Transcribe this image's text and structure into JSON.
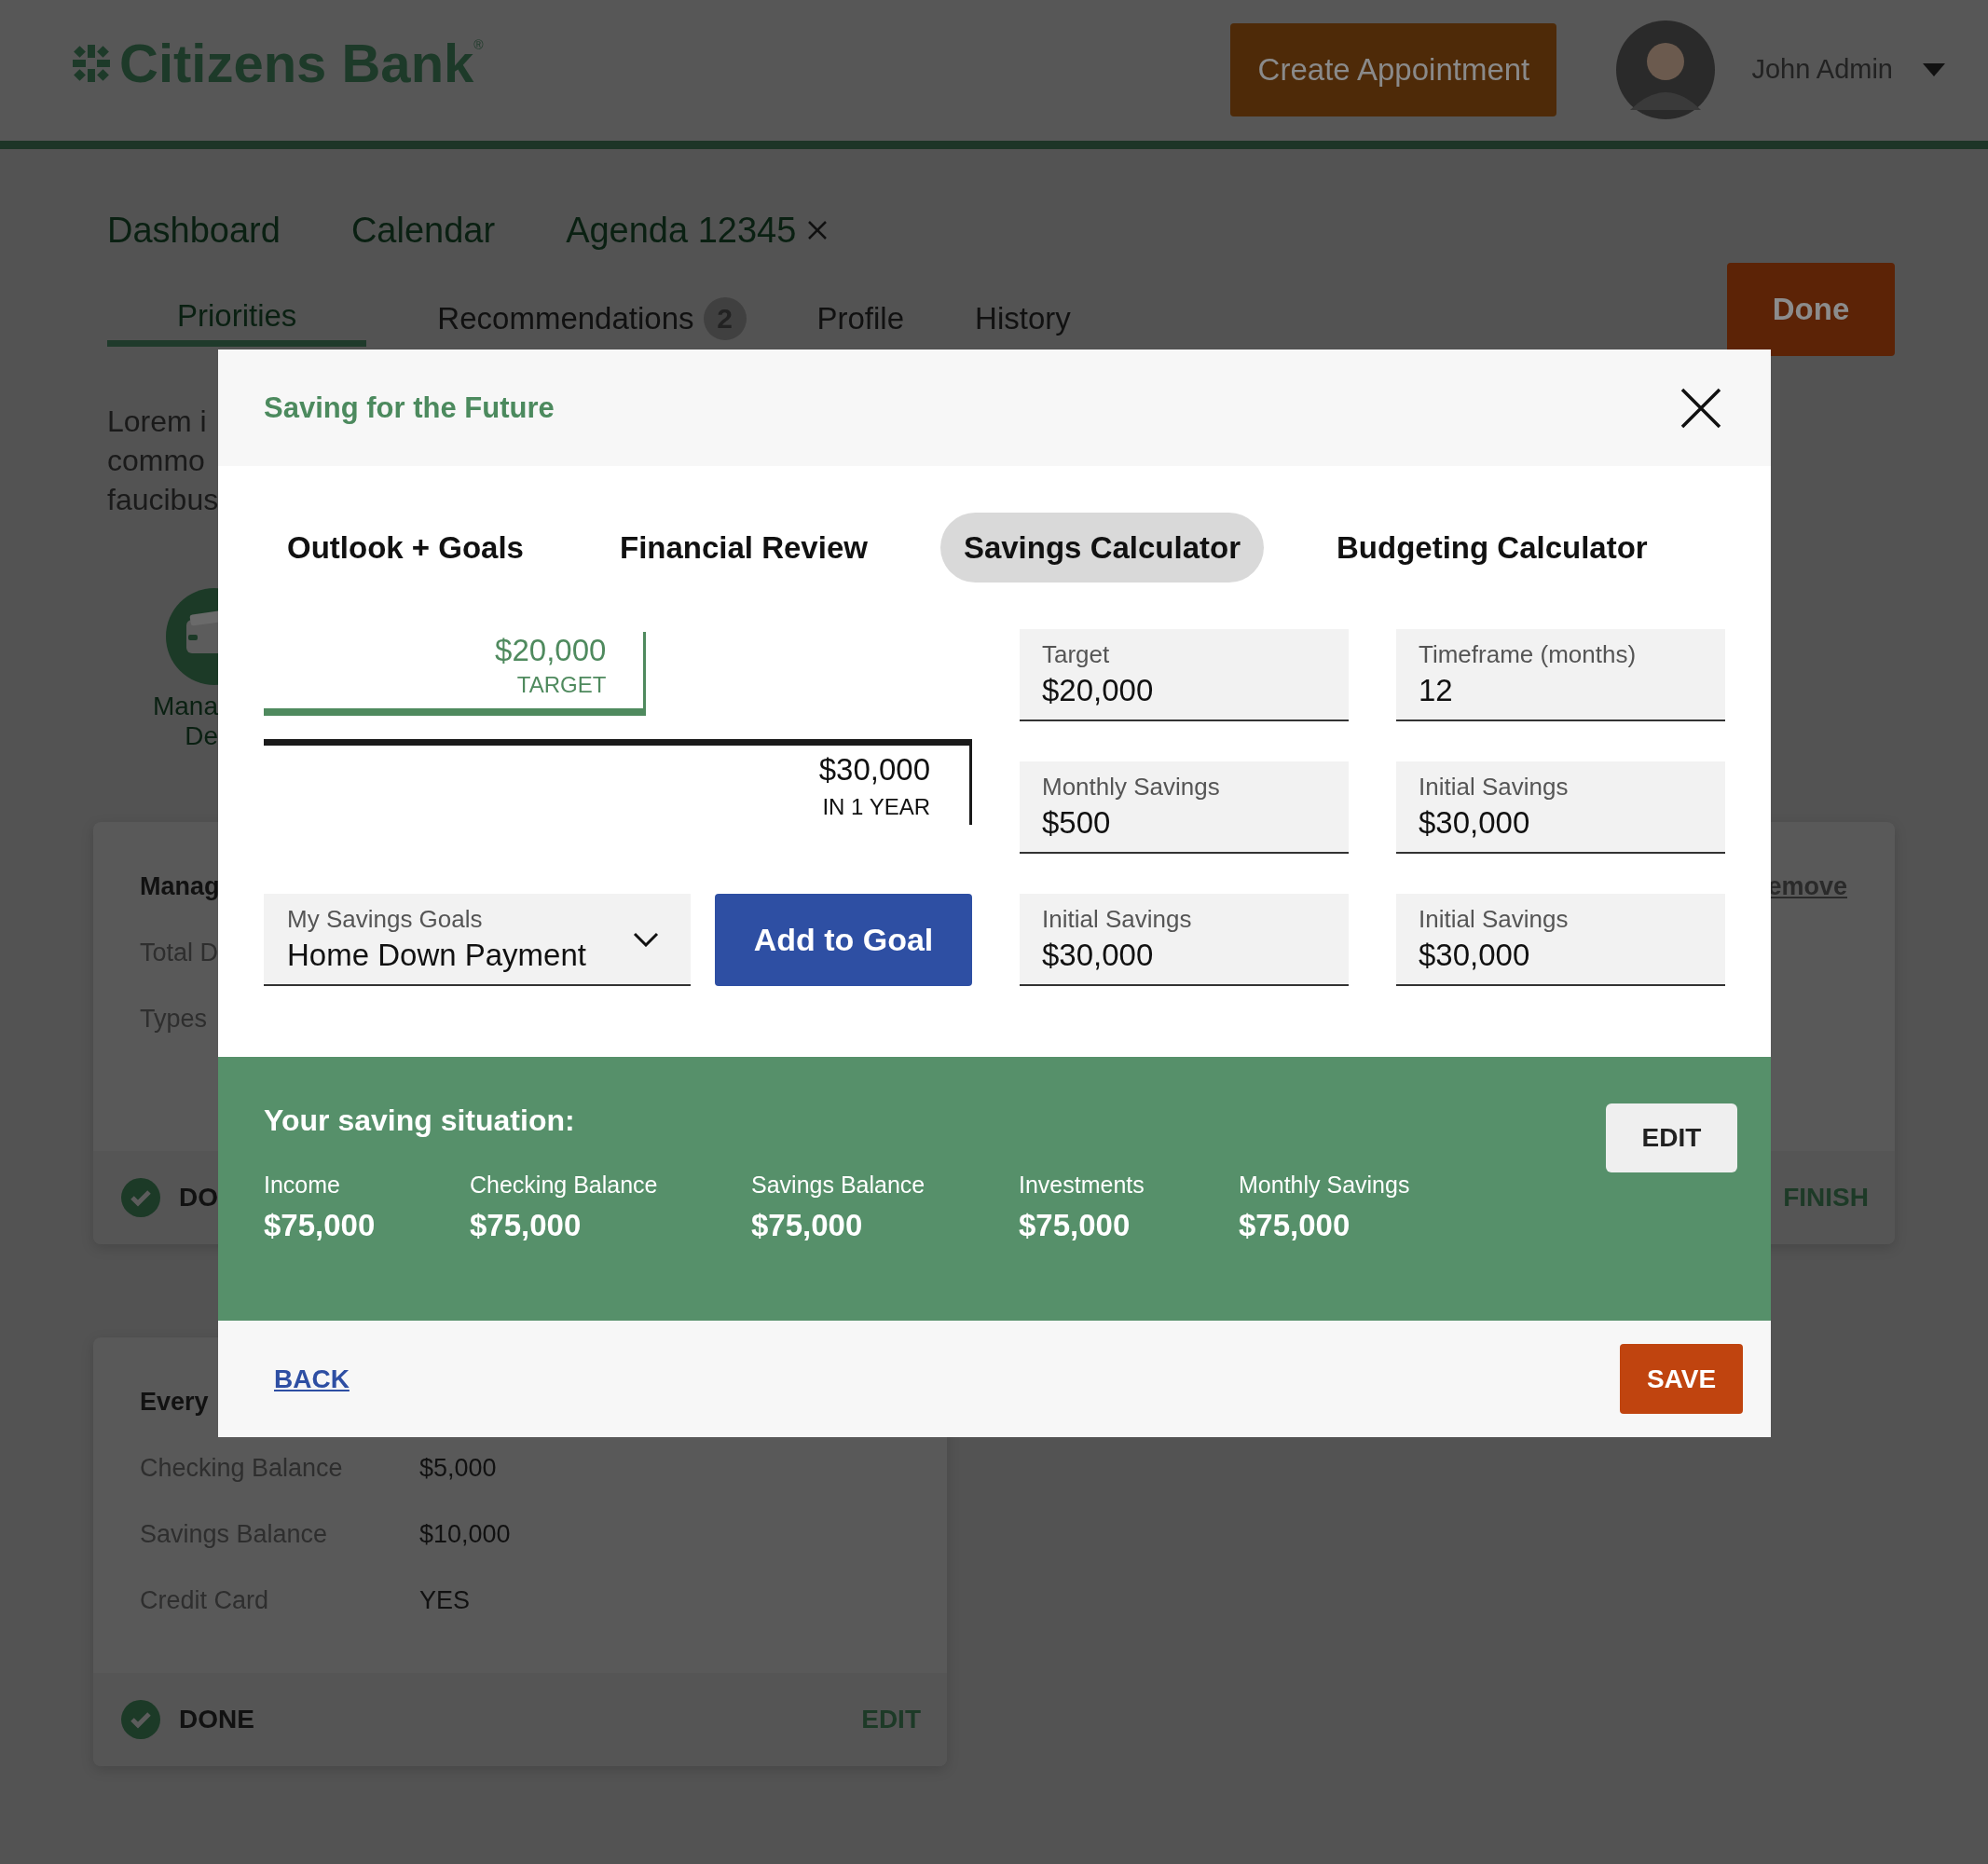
{
  "header": {
    "logo": "Citizens Bank$^{®}$",
    "create_button": "Create Appointment",
    "user_name": "John Admin"
  },
  "nav": [
    {
      "label": "Dashboard",
      "closable": false
    },
    {
      "label": "Calendar",
      "closable": false
    },
    {
      "label": "Agenda 12345",
      "closable": true
    }
  ],
  "tabs": [
    {
      "label": "Priorities",
      "selected": true
    },
    {
      "label": "Recommendations",
      "selected": false,
      "badge": "2"
    },
    {
      "label": "Profile",
      "selected": false
    },
    {
      "label": "History",
      "selected": false
    }
  ],
  "done_button": "Done",
  "intro_lines": [
    "Lorem i",
    "commo",
    "faucibus"
  ],
  "shortcut": {
    "label_lines": [
      "Mana",
      "De"
    ]
  },
  "cards": [
    {
      "title": "Manag",
      "link": "emove",
      "rows": [
        {
          "label": "Total D"
        },
        {
          "label": "Types"
        }
      ],
      "status": "DO",
      "done": true,
      "action": "FINISH"
    },
    {
      "title": "Every",
      "rows": [
        {
          "label": "Checking Balance",
          "value": "$5,000"
        },
        {
          "label": "Savings Balance",
          "value": "$10,000"
        },
        {
          "label": "Credit Card",
          "value": "YES"
        }
      ],
      "status": "DONE",
      "done": true,
      "action": "EDIT"
    }
  ],
  "modal": {
    "title": "Saving for the Future",
    "tabs": [
      {
        "label": "Outlook + Goals",
        "selected": false
      },
      {
        "label": "Financial Review",
        "selected": false
      },
      {
        "label": "Savings Calculator",
        "selected": true
      },
      {
        "label": "Budgeting Calculator",
        "selected": false
      }
    ],
    "chart": {
      "target_amount": "$20,000",
      "target_label": "TARGET",
      "projected_amount": "$30,000",
      "projected_label": "IN 1 YEAR"
    },
    "fields": [
      {
        "label": "Target",
        "value": "$20,000"
      },
      {
        "label": "Timeframe (months)",
        "value": "12"
      },
      {
        "label": "Monthly Savings",
        "value": "$500"
      },
      {
        "label": "Initial Savings",
        "value": "$30,000"
      },
      {
        "label": "Initial Savings",
        "value": "$30,000"
      },
      {
        "label": "Initial Savings",
        "value": "$30,000"
      }
    ],
    "goal_select": {
      "label": "My Savings Goals",
      "value": "Home Down Payment"
    },
    "add_button": "Add to Goal",
    "situation": {
      "title": "Your saving situation:",
      "edit_button": "EDIT",
      "items": [
        {
          "label": "Income",
          "value": "$75,000"
        },
        {
          "label": "Checking Balance",
          "value": "$75,000"
        },
        {
          "label": "Savings Balance",
          "value": "$75,000"
        },
        {
          "label": "Investments",
          "value": "$75,000"
        },
        {
          "label": "Monthly Savings",
          "value": "$75,000"
        }
      ]
    },
    "back_link": "BACK",
    "save_button": "SAVE"
  }
}
